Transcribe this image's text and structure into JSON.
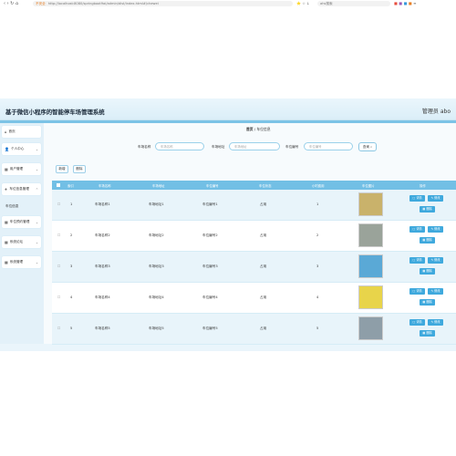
{
  "browser": {
    "nav_icons": "‹ › ↻ ⌂",
    "warning": "不安全",
    "url": "http://localhost:8080/springboot9ai/admin/dist/index.html#/chewei",
    "search_placeholder": "ahs搜索",
    "icons": "⭐ ☆ ↓"
  },
  "app": {
    "title": "基于微信小程序的智能停车场管理系统",
    "user": "管理员 abo"
  },
  "sidebar": {
    "items": [
      {
        "label": "首页",
        "icon": "⌂"
      },
      {
        "label": "个人中心",
        "icon": "👤"
      },
      {
        "label": "用户管理",
        "icon": "▦"
      },
      {
        "label": "车位信息管理",
        "icon": "✈"
      },
      {
        "label": "车位预约管理",
        "icon": "▦"
      },
      {
        "label": "系统论坛",
        "icon": "▦"
      },
      {
        "label": "系统管理",
        "icon": "▦"
      }
    ],
    "sub_item": "车位信息"
  },
  "breadcrumb": {
    "home": "首页",
    "sep": "/",
    "current": "车位信息"
  },
  "filters": {
    "f1_label": "车场名称",
    "f1_placeholder": "车场名称",
    "f2_label": "车场地址",
    "f2_placeholder": "车场地址",
    "f3_label": "车位编号",
    "f3_placeholder": "车位编号",
    "query": "查询"
  },
  "actions": {
    "add": "新增",
    "delete": "删除",
    "detail": "详情",
    "edit": "修改",
    "remove": "删除"
  },
  "table": {
    "headers": [
      "索引",
      "车场名称",
      "车场地址",
      "车位编号",
      "车位状态",
      "小时费用",
      "车位图片",
      "操作"
    ],
    "rows": [
      {
        "index": "1",
        "name": "车场名称1",
        "address": "车场地址1",
        "code": "车位编号1",
        "status": "占用",
        "fee": "1",
        "image_color": "#c9b26b"
      },
      {
        "index": "2",
        "name": "车场名称2",
        "address": "车场地址2",
        "code": "车位编号2",
        "status": "占用",
        "fee": "2",
        "image_color": "#9aa39a"
      },
      {
        "index": "3",
        "name": "车场名称3",
        "address": "车场地址3",
        "code": "车位编号3",
        "status": "占用",
        "fee": "3",
        "image_color": "#5aa9d6"
      },
      {
        "index": "4",
        "name": "车场名称4",
        "address": "车场地址4",
        "code": "车位编号4",
        "status": "占用",
        "fee": "4",
        "image_color": "#e8d44a"
      },
      {
        "index": "5",
        "name": "车场名称5",
        "address": "车场地址5",
        "code": "车位编号5",
        "status": "占用",
        "fee": "5",
        "image_color": "#8e9ea8"
      }
    ]
  },
  "colors": {
    "accent": "#72bfe5",
    "button": "#3fa9dd"
  }
}
